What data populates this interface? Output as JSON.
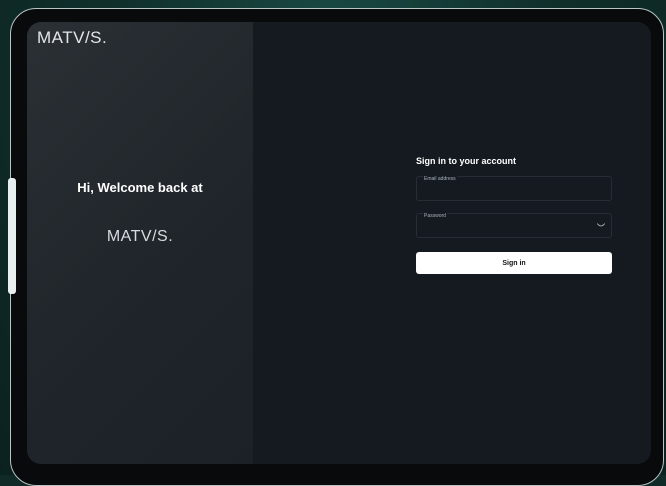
{
  "left_panel": {
    "brand_corner": "MATV/S.",
    "welcome": "Hi, Welcome back at",
    "brand_center": "MATV/S."
  },
  "login_form": {
    "title": "Sign in to your account",
    "email": {
      "label": "Email address",
      "value": ""
    },
    "password": {
      "label": "Password",
      "value": "",
      "toggle_icon": "eye-toggle-icon"
    },
    "submit_label": "Sign in"
  },
  "colors": {
    "backdrop": "#10302c",
    "left_panel": "#262b30",
    "right_panel": "#141a20",
    "button_bg": "#ffffff",
    "button_text": "#111111"
  }
}
